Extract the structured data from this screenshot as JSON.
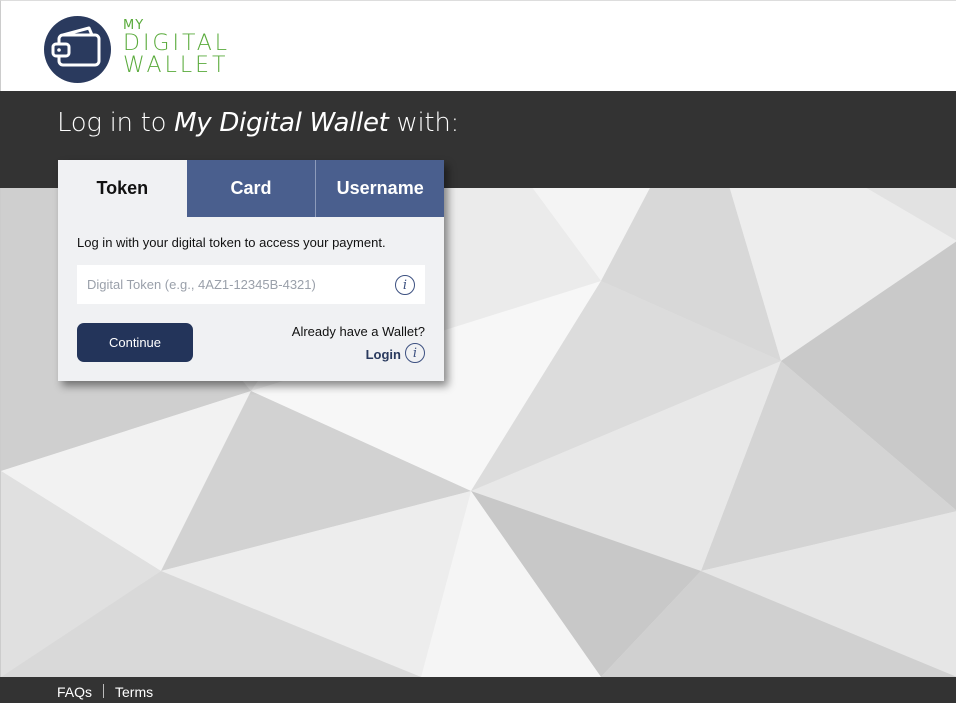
{
  "logo": {
    "line1": "MY",
    "line2": "DIGITAL",
    "line3": "WALLET",
    "icon": "wallet-icon",
    "brand_color": "#5aab3c",
    "circle_color": "#2a3a5e"
  },
  "headline": {
    "prefix": "Log in to ",
    "brand": "My Digital Wallet",
    "suffix": " with:"
  },
  "tabs": [
    {
      "label": "Token",
      "active": true
    },
    {
      "label": "Card",
      "active": false
    },
    {
      "label": "Username",
      "active": false
    }
  ],
  "token_form": {
    "description": "Log in with your digital token to access your payment.",
    "input_placeholder": "Digital Token (e.g., 4AZ1-12345B-4321)",
    "input_value": "",
    "info_icon": "info-icon",
    "continue_label": "Continue",
    "already_text": "Already have a Wallet?",
    "login_label": "Login"
  },
  "footer": {
    "faqs_label": "FAQs",
    "terms_label": "Terms"
  },
  "colors": {
    "dark_band": "#333333",
    "tab_inactive": "#4a5f8e",
    "button": "#23345a"
  }
}
